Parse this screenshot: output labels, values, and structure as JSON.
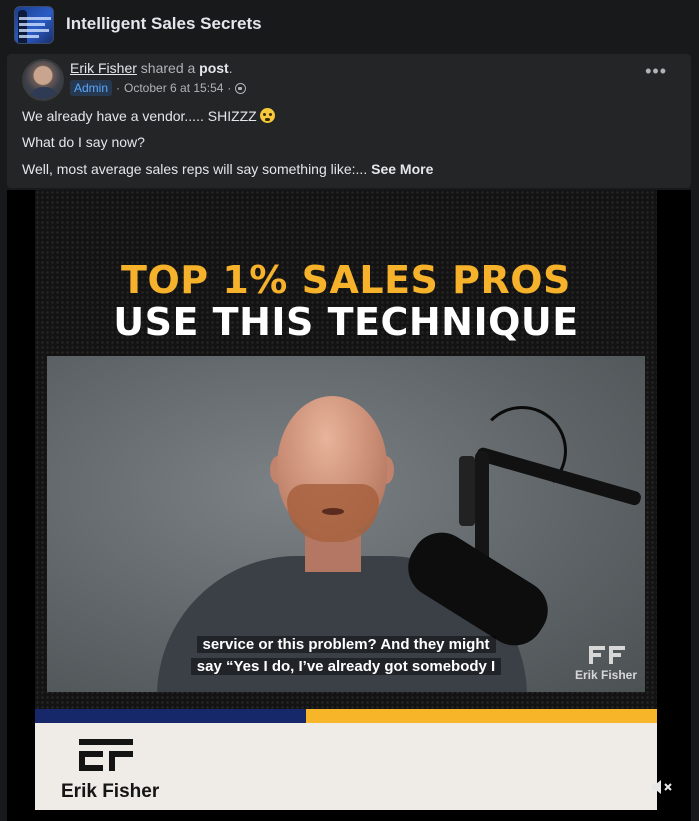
{
  "group": {
    "title": "Intelligent Sales Secrets"
  },
  "post": {
    "author": "Erik Fisher",
    "shared_text": "shared a",
    "post_word": "post",
    "period": ".",
    "badge": "Admin",
    "separator": "·",
    "timestamp": "October 6 at 15:54",
    "separator2": "·",
    "more_icon": "•••",
    "line1": "We already have a vendor..... SHIZZZ",
    "line2": "What do I say now?",
    "line3": "Well, most average sales reps will say something like:...",
    "see_more": "See More"
  },
  "video": {
    "headline1": "TOP 1% SALES PROS",
    "headline2": "USE THIS TECHNIQUE",
    "caption_line1": "service or this problem? And they might",
    "caption_line2": "say “Yes I do, I’ve already got somebody I",
    "watermark_text": "Erik Fisher",
    "brand_name": "Erik Fisher",
    "colors": {
      "gold": "#f6b22a",
      "navy": "#16286a",
      "cream": "#efebe6"
    }
  },
  "icons": {
    "more": "more-options-icon",
    "privacy": "globe-icon",
    "volume": "volume-muted-icon",
    "logo": "ef-logo-icon"
  }
}
